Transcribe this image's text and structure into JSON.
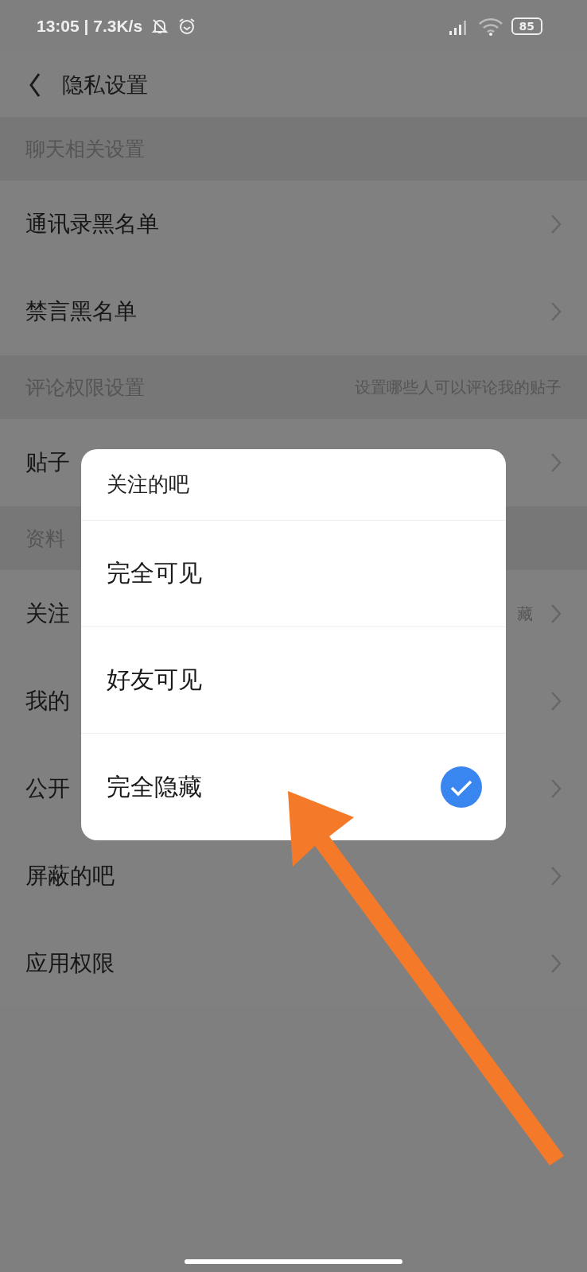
{
  "status_bar": {
    "time": "13:05 | 7.3K/s",
    "battery": "85"
  },
  "header": {
    "title": "隐私设置"
  },
  "sections": [
    {
      "title": "聊天相关设置",
      "items": [
        {
          "label": "通讯录黑名单"
        },
        {
          "label": "禁言黑名单"
        }
      ]
    },
    {
      "title": "评论权限设置",
      "note": "设置哪些人可以评论我的贴子",
      "items": [
        {
          "label": "贴子"
        }
      ]
    },
    {
      "title": "资料",
      "items": [
        {
          "label": "关注",
          "value": "藏"
        },
        {
          "label": "我的"
        },
        {
          "label": "公开"
        },
        {
          "label": "屏蔽的吧"
        },
        {
          "label": "应用权限"
        }
      ]
    }
  ],
  "dialog": {
    "title": "关注的吧",
    "options": [
      {
        "label": "完全可见",
        "selected": false
      },
      {
        "label": "好友可见",
        "selected": false
      },
      {
        "label": "完全隐藏",
        "selected": true
      }
    ]
  }
}
